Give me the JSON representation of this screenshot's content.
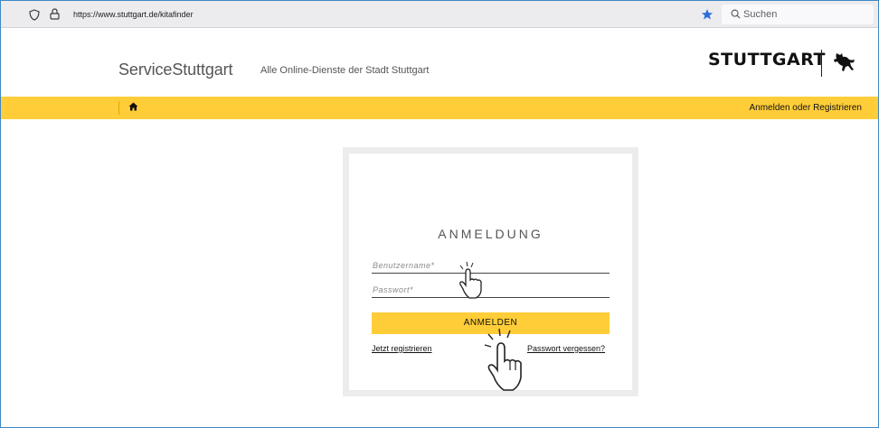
{
  "browser": {
    "url": "https://www.stuttgart.de/kitafinder",
    "search_placeholder": "Suchen",
    "accent_color": "#2a6fdb"
  },
  "header": {
    "brand": "ServiceStuttgart",
    "tagline": "Alle Online-Dienste der Stadt Stuttgart",
    "logo_text": "STUTTGART"
  },
  "nav": {
    "home_icon": "home-icon",
    "login_link": "Anmelden oder Registrieren",
    "color": "#ffcd38"
  },
  "login": {
    "title": "ANMELDUNG",
    "username_placeholder": "Benutzername*",
    "password_placeholder": "Passwort*",
    "submit_label": "ANMELDEN",
    "register_link": "Jetzt registrieren",
    "forgot_link": "Passwort vergessen?"
  },
  "overlays": {
    "cursor_icon": "pointer-hand-icon"
  }
}
